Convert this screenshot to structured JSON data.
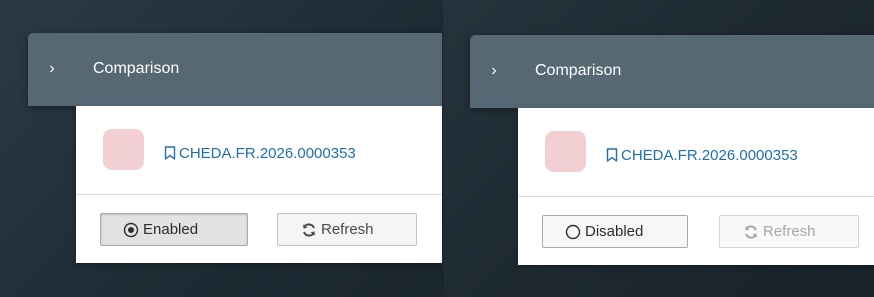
{
  "left": {
    "header": {
      "title": "Comparison",
      "chevron_icon": "chevron-right-icon"
    },
    "record": {
      "id": "CHEDA.FR.2026.0000353",
      "icon": "bookmark-icon",
      "avatar_color": "#f1cfd3"
    },
    "toggle": {
      "label": "Enabled",
      "icon": "radio-checked-icon",
      "state": "enabled"
    },
    "refresh": {
      "label": "Refresh",
      "icon": "refresh-icon",
      "disabled": false
    }
  },
  "right": {
    "header": {
      "title": "Comparison",
      "chevron_icon": "chevron-right-icon"
    },
    "record": {
      "id": "CHEDA.FR.2026.0000353",
      "icon": "bookmark-icon",
      "avatar_color": "#f1cfd3"
    },
    "toggle": {
      "label": "Disabled",
      "icon": "radio-unchecked-icon",
      "state": "disabled"
    },
    "refresh": {
      "label": "Refresh",
      "icon": "refresh-icon",
      "disabled": true
    }
  },
  "colors": {
    "header_bg": "#566874",
    "link": "#1f6fb0",
    "panel_bg": "#ffffff"
  }
}
